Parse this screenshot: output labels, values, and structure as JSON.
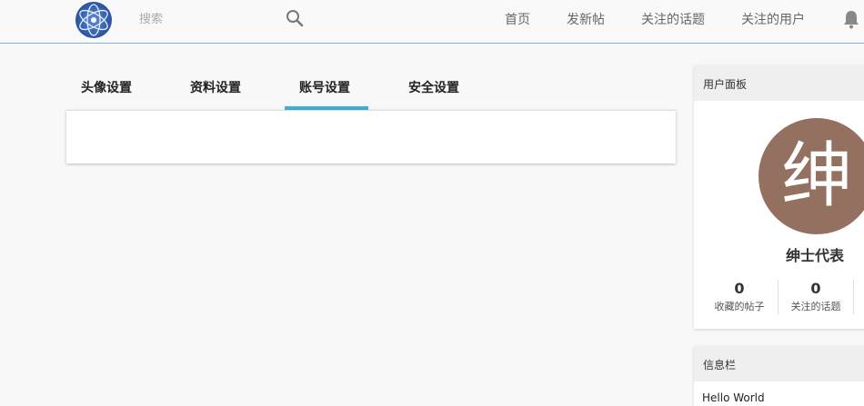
{
  "header": {
    "logo_icon": "orbit-globe-logo",
    "search": {
      "placeholder": "搜索",
      "value": ""
    },
    "nav": [
      "首页",
      "发新帖",
      "关注的话题",
      "关注的用户"
    ],
    "bell_icon": "bell-icon"
  },
  "tabs": {
    "items": [
      "头像设置",
      "资料设置",
      "账号设置",
      "安全设置"
    ],
    "active_index": 2,
    "accent_color": "#3fb0d6"
  },
  "user_panel": {
    "title": "用户面板",
    "avatar_char": "绅",
    "avatar_color": "#947060",
    "username": "绅士代表",
    "stats": [
      {
        "value": "0",
        "label": "收藏的帖子"
      },
      {
        "value": "0",
        "label": "关注的话题"
      }
    ]
  },
  "info_panel": {
    "title": "信息栏",
    "text": "Hello World"
  }
}
